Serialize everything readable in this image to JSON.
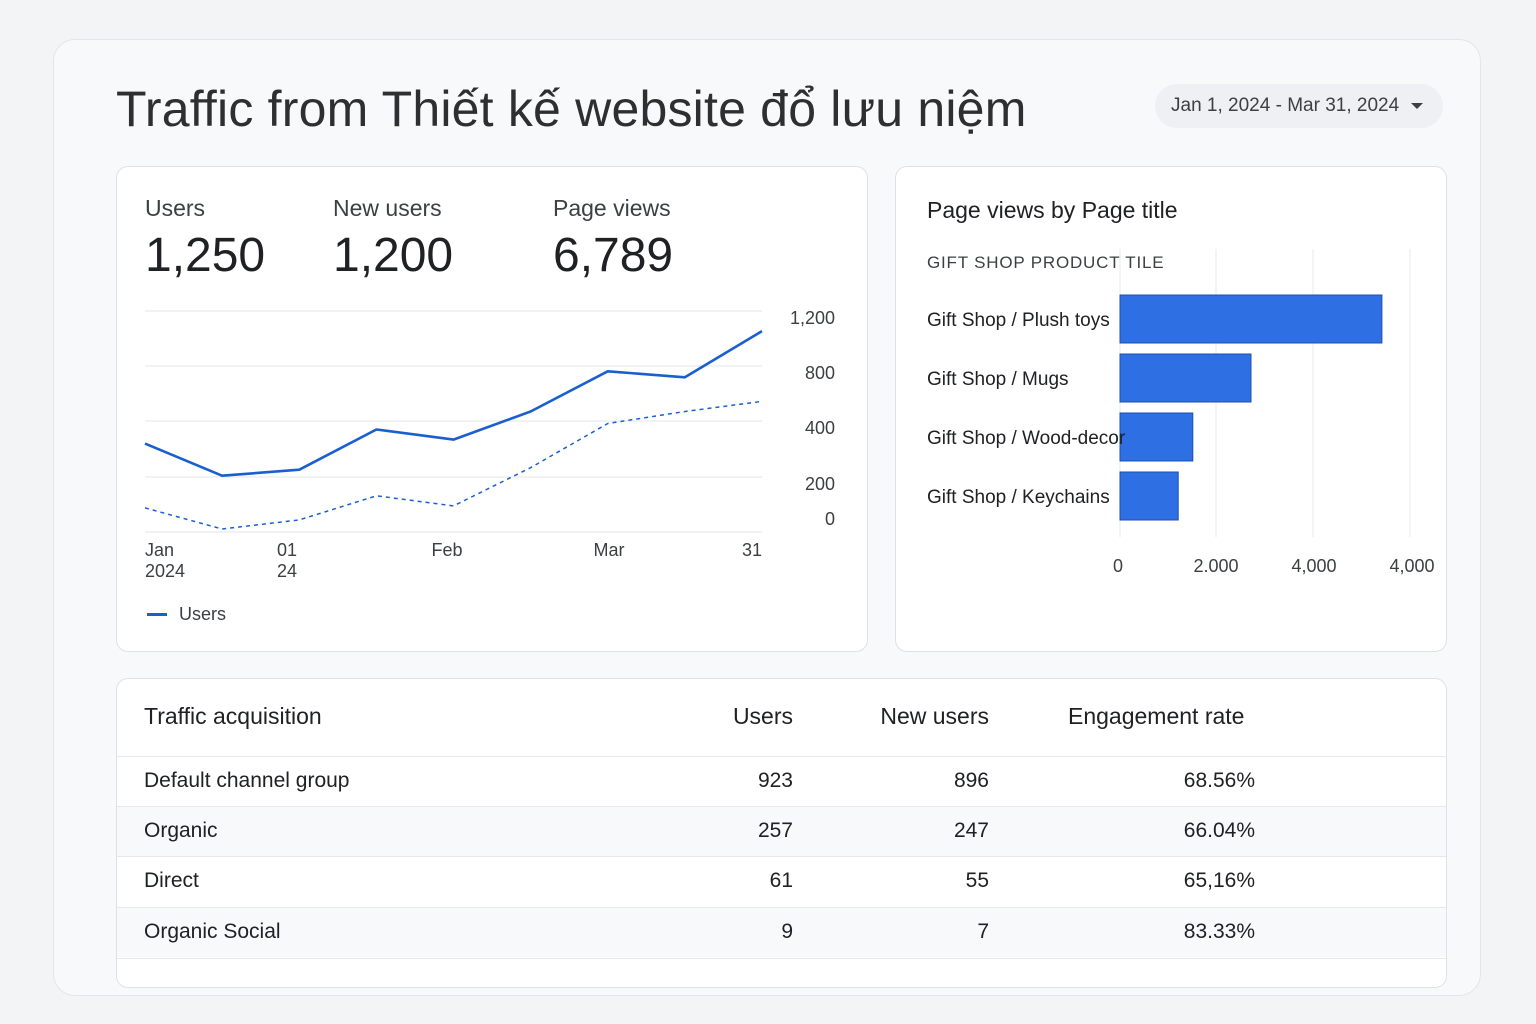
{
  "page": {
    "title": "Traffic from Thiết kế website đổ lưu niệm",
    "date_range": "Jan 1, 2024 - Mar 31, 2024"
  },
  "metrics": [
    {
      "label": "Users",
      "value": "1,250"
    },
    {
      "label": "New users",
      "value": "1,200"
    },
    {
      "label": "Page views",
      "value": "6,789"
    }
  ],
  "line_legend": "Users",
  "bar_panel": {
    "title": "Page views by Page title",
    "subtitle": "GIFT SHOP PRODUCT TILE"
  },
  "table": {
    "headers": [
      "Traffic acquisition",
      "Users",
      "New users",
      "Engagement rate"
    ],
    "rows": [
      [
        "Default channel group",
        "923",
        "896",
        "68.56%"
      ],
      [
        "Organic",
        "257",
        "247",
        "66.04%"
      ],
      [
        "Direct",
        "61",
        "55",
        "65,16%"
      ],
      [
        "Organic Social",
        "9",
        "7",
        "83.33%"
      ]
    ]
  },
  "colors": {
    "accent": "#1a5fd0",
    "bar": "#2f6fe4"
  },
  "chart_data": [
    {
      "type": "line",
      "x_tick_labels": [
        [
          "Jan",
          "2024"
        ],
        [
          "01",
          "24"
        ],
        [
          "Feb"
        ],
        [
          "Mar"
        ],
        [
          "31"
        ]
      ],
      "y_tick_labels": [
        "1,200",
        "800",
        "400",
        "200",
        "0"
      ],
      "grid": true,
      "legend": "bottom-left",
      "series": [
        {
          "name": "Users",
          "style": "solid",
          "values": [
            440,
            280,
            310,
            510,
            460,
            600,
            800,
            770,
            1000
          ]
        },
        {
          "style": "dashed",
          "values": [
            120,
            15,
            60,
            180,
            130,
            320,
            540,
            600,
            650
          ]
        }
      ]
    },
    {
      "type": "bar",
      "orientation": "horizontal",
      "categories": [
        "Gift Shop / Plush toys",
        "Gift Shop / Mugs",
        "Gift Shop / Wood-decor",
        "Gift Shop / Keychains"
      ],
      "values": [
        5400,
        2700,
        1500,
        1200
      ],
      "x_tick_labels": [
        "0",
        "2.000",
        "4,000",
        "4,000"
      ],
      "xlim": [
        0,
        6000
      ],
      "grid": true
    }
  ]
}
